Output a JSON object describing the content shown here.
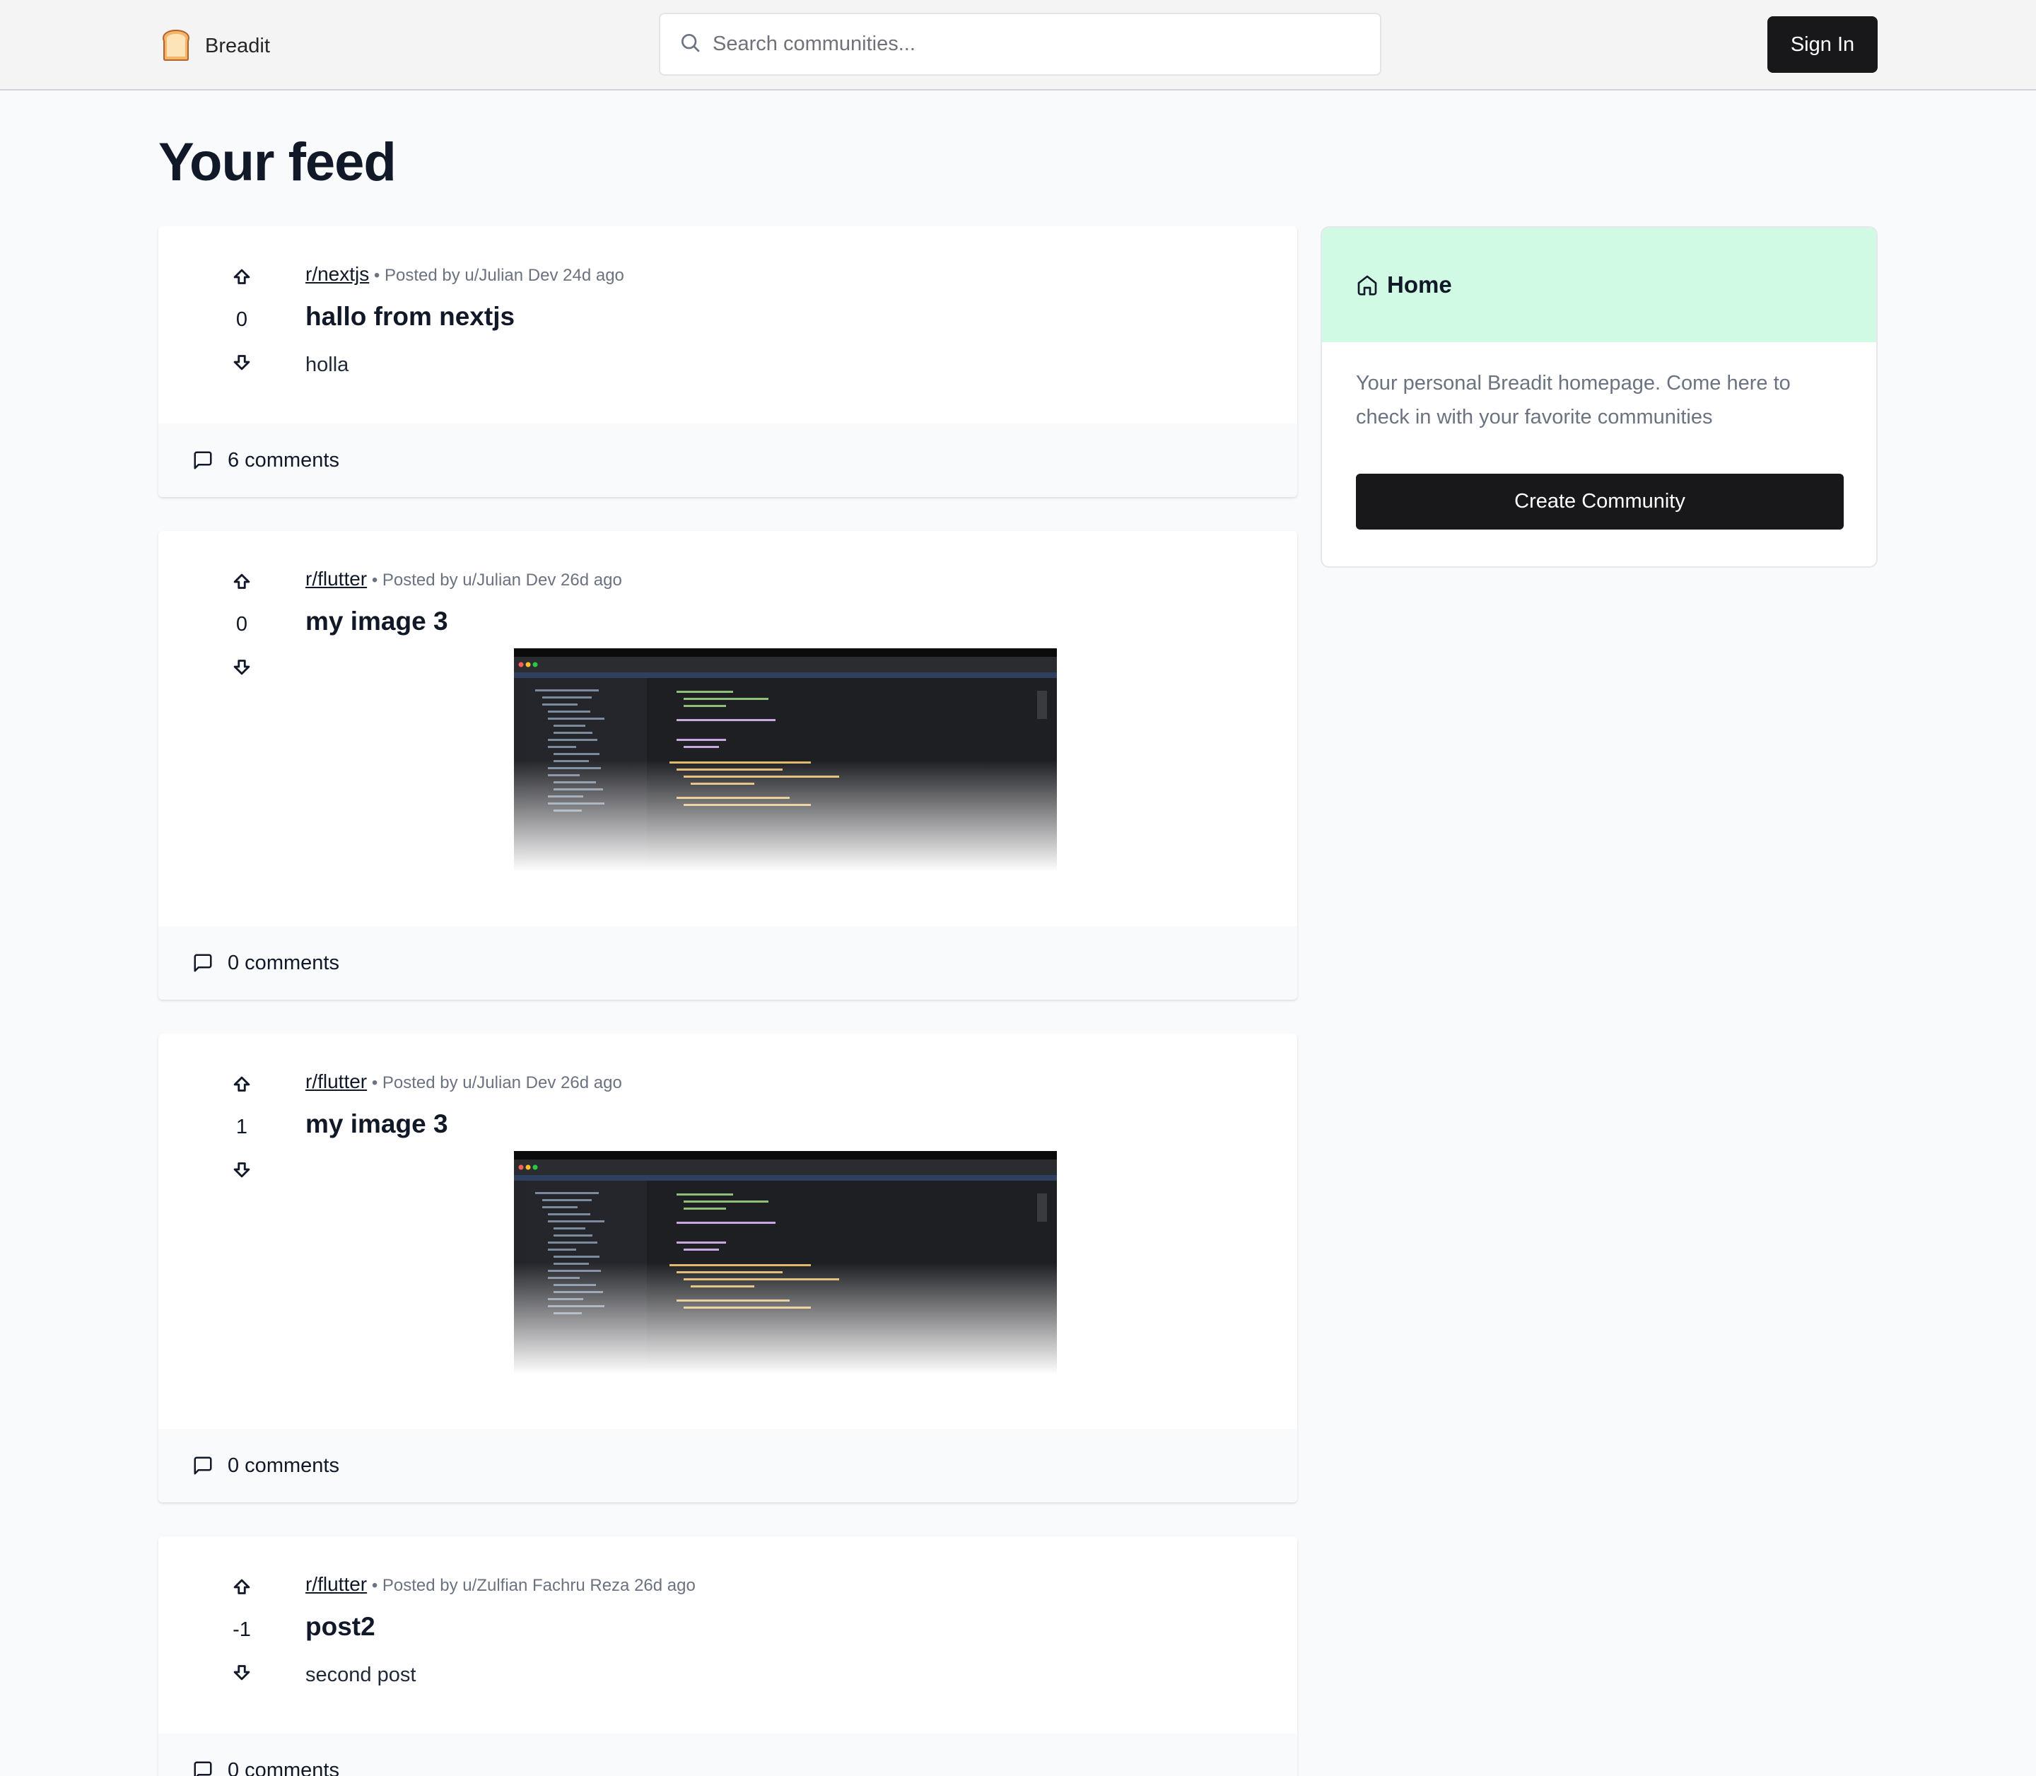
{
  "header": {
    "brand": "Breadit",
    "search_placeholder": "Search communities...",
    "signin_label": "Sign In"
  },
  "page": {
    "title": "Your feed"
  },
  "posts": [
    {
      "subreddit": "r/nextjs",
      "meta": "Posted by u/Julian Dev 24d ago",
      "title": "hallo from nextjs",
      "content": "holla",
      "votes": "0",
      "comments": "6 comments"
    },
    {
      "subreddit": "r/flutter",
      "meta": "Posted by u/Julian Dev 26d ago",
      "title": "my image 3",
      "votes": "0",
      "comments": "0 comments"
    },
    {
      "subreddit": "r/flutter",
      "meta": "Posted by u/Julian Dev 26d ago",
      "title": "my image 3",
      "votes": "1",
      "comments": "0 comments"
    },
    {
      "subreddit": "r/flutter",
      "meta": "Posted by u/Zulfian Fachru Reza 26d ago",
      "title": "post2",
      "content": "second post",
      "votes": "-1",
      "comments": "0 comments"
    }
  ],
  "sidebar": {
    "title": "Home",
    "description": "Your personal Breadit homepage. Come here to check in with your favorite communities",
    "create_label": "Create Community"
  },
  "icons": {
    "brand": "bread-icon",
    "search": "search-icon",
    "upvote": "arrow-big-up-icon",
    "downvote": "arrow-big-down-icon",
    "comments": "message-square-icon",
    "home": "home-icon"
  },
  "colors": {
    "accent_dark": "#18181b",
    "sidebar_header": "#d1fae5",
    "page_bg": "#f8fafc"
  }
}
